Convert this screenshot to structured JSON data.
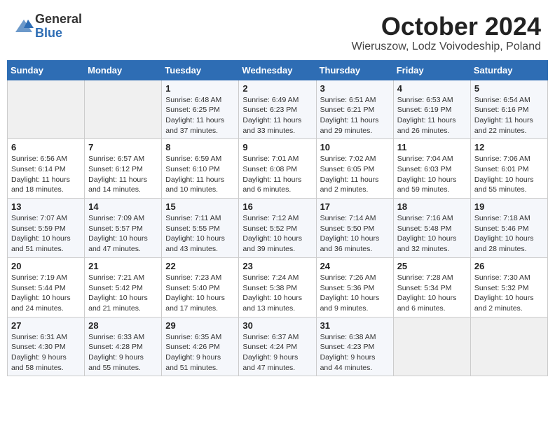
{
  "header": {
    "logo": {
      "general": "General",
      "blue": "Blue"
    },
    "title": "October 2024",
    "location": "Wieruszow, Lodz Voivodeship, Poland"
  },
  "weekdays": [
    "Sunday",
    "Monday",
    "Tuesday",
    "Wednesday",
    "Thursday",
    "Friday",
    "Saturday"
  ],
  "weeks": [
    [
      {
        "day": "",
        "info": ""
      },
      {
        "day": "",
        "info": ""
      },
      {
        "day": "1",
        "info": "Sunrise: 6:48 AM\nSunset: 6:25 PM\nDaylight: 11 hours\nand 37 minutes."
      },
      {
        "day": "2",
        "info": "Sunrise: 6:49 AM\nSunset: 6:23 PM\nDaylight: 11 hours\nand 33 minutes."
      },
      {
        "day": "3",
        "info": "Sunrise: 6:51 AM\nSunset: 6:21 PM\nDaylight: 11 hours\nand 29 minutes."
      },
      {
        "day": "4",
        "info": "Sunrise: 6:53 AM\nSunset: 6:19 PM\nDaylight: 11 hours\nand 26 minutes."
      },
      {
        "day": "5",
        "info": "Sunrise: 6:54 AM\nSunset: 6:16 PM\nDaylight: 11 hours\nand 22 minutes."
      }
    ],
    [
      {
        "day": "6",
        "info": "Sunrise: 6:56 AM\nSunset: 6:14 PM\nDaylight: 11 hours\nand 18 minutes."
      },
      {
        "day": "7",
        "info": "Sunrise: 6:57 AM\nSunset: 6:12 PM\nDaylight: 11 hours\nand 14 minutes."
      },
      {
        "day": "8",
        "info": "Sunrise: 6:59 AM\nSunset: 6:10 PM\nDaylight: 11 hours\nand 10 minutes."
      },
      {
        "day": "9",
        "info": "Sunrise: 7:01 AM\nSunset: 6:08 PM\nDaylight: 11 hours\nand 6 minutes."
      },
      {
        "day": "10",
        "info": "Sunrise: 7:02 AM\nSunset: 6:05 PM\nDaylight: 11 hours\nand 2 minutes."
      },
      {
        "day": "11",
        "info": "Sunrise: 7:04 AM\nSunset: 6:03 PM\nDaylight: 10 hours\nand 59 minutes."
      },
      {
        "day": "12",
        "info": "Sunrise: 7:06 AM\nSunset: 6:01 PM\nDaylight: 10 hours\nand 55 minutes."
      }
    ],
    [
      {
        "day": "13",
        "info": "Sunrise: 7:07 AM\nSunset: 5:59 PM\nDaylight: 10 hours\nand 51 minutes."
      },
      {
        "day": "14",
        "info": "Sunrise: 7:09 AM\nSunset: 5:57 PM\nDaylight: 10 hours\nand 47 minutes."
      },
      {
        "day": "15",
        "info": "Sunrise: 7:11 AM\nSunset: 5:55 PM\nDaylight: 10 hours\nand 43 minutes."
      },
      {
        "day": "16",
        "info": "Sunrise: 7:12 AM\nSunset: 5:52 PM\nDaylight: 10 hours\nand 39 minutes."
      },
      {
        "day": "17",
        "info": "Sunrise: 7:14 AM\nSunset: 5:50 PM\nDaylight: 10 hours\nand 36 minutes."
      },
      {
        "day": "18",
        "info": "Sunrise: 7:16 AM\nSunset: 5:48 PM\nDaylight: 10 hours\nand 32 minutes."
      },
      {
        "day": "19",
        "info": "Sunrise: 7:18 AM\nSunset: 5:46 PM\nDaylight: 10 hours\nand 28 minutes."
      }
    ],
    [
      {
        "day": "20",
        "info": "Sunrise: 7:19 AM\nSunset: 5:44 PM\nDaylight: 10 hours\nand 24 minutes."
      },
      {
        "day": "21",
        "info": "Sunrise: 7:21 AM\nSunset: 5:42 PM\nDaylight: 10 hours\nand 21 minutes."
      },
      {
        "day": "22",
        "info": "Sunrise: 7:23 AM\nSunset: 5:40 PM\nDaylight: 10 hours\nand 17 minutes."
      },
      {
        "day": "23",
        "info": "Sunrise: 7:24 AM\nSunset: 5:38 PM\nDaylight: 10 hours\nand 13 minutes."
      },
      {
        "day": "24",
        "info": "Sunrise: 7:26 AM\nSunset: 5:36 PM\nDaylight: 10 hours\nand 9 minutes."
      },
      {
        "day": "25",
        "info": "Sunrise: 7:28 AM\nSunset: 5:34 PM\nDaylight: 10 hours\nand 6 minutes."
      },
      {
        "day": "26",
        "info": "Sunrise: 7:30 AM\nSunset: 5:32 PM\nDaylight: 10 hours\nand 2 minutes."
      }
    ],
    [
      {
        "day": "27",
        "info": "Sunrise: 6:31 AM\nSunset: 4:30 PM\nDaylight: 9 hours\nand 58 minutes."
      },
      {
        "day": "28",
        "info": "Sunrise: 6:33 AM\nSunset: 4:28 PM\nDaylight: 9 hours\nand 55 minutes."
      },
      {
        "day": "29",
        "info": "Sunrise: 6:35 AM\nSunset: 4:26 PM\nDaylight: 9 hours\nand 51 minutes."
      },
      {
        "day": "30",
        "info": "Sunrise: 6:37 AM\nSunset: 4:24 PM\nDaylight: 9 hours\nand 47 minutes."
      },
      {
        "day": "31",
        "info": "Sunrise: 6:38 AM\nSunset: 4:23 PM\nDaylight: 9 hours\nand 44 minutes."
      },
      {
        "day": "",
        "info": ""
      },
      {
        "day": "",
        "info": ""
      }
    ]
  ]
}
